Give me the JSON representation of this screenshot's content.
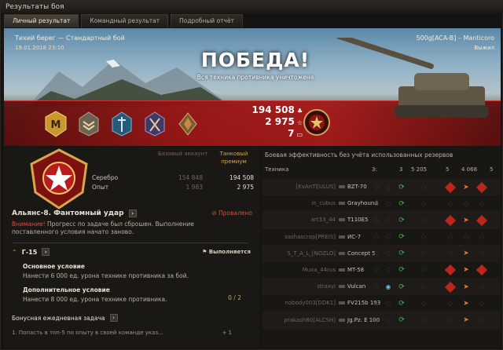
{
  "window": {
    "title": "Результаты боя"
  },
  "tabs": [
    {
      "label": "Личный результат",
      "active": true
    },
    {
      "label": "Командный результат",
      "active": false
    },
    {
      "label": "Подробный отчёт",
      "active": false
    }
  ],
  "hero": {
    "map_mode": "Тихий берег — Стандартный бой",
    "datetime": "19.01.2018 23:10",
    "player": "500g[ACA-B] – Manticoro",
    "vehicle_status": "Выжил",
    "result": "ПОБЕДА!",
    "result_sub": "Вся техника противника уничтожена",
    "credits_total": "194 508",
    "xp_total": "2 975",
    "free_xp_total": "7",
    "medals": [
      "mastery-badge-m",
      "sergeant-stripes-icon",
      "shield-medal-icon",
      "crossed-medal-icon",
      "diamond-medal-icon"
    ],
    "accent_red": "#a01818"
  },
  "earnings": {
    "base_label": "Базовый аккаунт",
    "premium_label": "Танковый премиум",
    "rows": [
      {
        "label": "Серебро",
        "base": "154 848",
        "premium": "194 508"
      },
      {
        "label": "Опыт",
        "base": "1 983",
        "premium": "2 975"
      }
    ]
  },
  "task": {
    "title": "Альянс-8. Фантомный удар",
    "status": "Провалено",
    "warning_word": "Внимание!",
    "warning_text": " Прогресс по задаче был сброшен. Выполнение поставленного условия начато заново.",
    "tank": "Г-15",
    "tank_status": "Выполняется",
    "main_cond_title": "Основное условие",
    "main_cond_text": "Нанести 6 000 ед. урона технике противника за бой.",
    "extra_cond_title": "Дополнительное условие",
    "extra_cond_text": "Нанести 8 000 ед. урона технике противника.",
    "extra_progress": "0 / 2",
    "daily_title": "Бонусная ежедневная задача",
    "daily_item": "1. Попасть в топ-5 по опыту в своей команде указ...",
    "daily_reward": "+ 1"
  },
  "efficiency": {
    "title": "Боевая эффективность без учёта использованных резервов",
    "col_tech": "Техника",
    "col_values": [
      "3:",
      "3",
      "5 205",
      "5",
      "4 068",
      "5"
    ],
    "rows": [
      {
        "player": "[KvAnTl[ULUS]",
        "tank": "BZT-70",
        "icons": [
          "dim",
          "dim",
          "green",
          "dim",
          "red",
          "orange",
          "red"
        ]
      },
      {
        "player": "in_cubus",
        "tank": "Grayhound",
        "icons": [
          "dim",
          "dim",
          "green",
          "dim",
          "dim",
          "dim",
          "dim"
        ]
      },
      {
        "player": "art33_44",
        "tank": "T110E5",
        "icons": [
          "dim",
          "dim",
          "green",
          "dim",
          "red",
          "orange",
          "red"
        ]
      },
      {
        "player": "sashascrap[PREIS]",
        "tank": "ИС-7",
        "icons": [
          "dim",
          "dim",
          "green",
          "dim",
          "dim",
          "dim",
          "dim"
        ]
      },
      {
        "player": "S_T_A_L_[NOZLO]",
        "tank": "Concept 5",
        "icons": [
          "dim",
          "dim",
          "green",
          "dim",
          "dim",
          "orange",
          "dim"
        ]
      },
      {
        "player": "Muxa_44rus",
        "tank": "MT-58",
        "icons": [
          "dim",
          "dim",
          "green",
          "dim",
          "red",
          "orange",
          "red"
        ]
      },
      {
        "player": "straxyi",
        "tank": "Vulcan",
        "icons": [
          "dim",
          "blue",
          "green",
          "dim",
          "red",
          "orange",
          "dim"
        ]
      },
      {
        "player": "nobody003[DDK1]",
        "tank": "FV215b 183",
        "icons": [
          "dim",
          "dim",
          "green",
          "dim",
          "dim",
          "orange",
          "dim"
        ]
      },
      {
        "player": "prakash80[ALCSH]",
        "tank": "Jg.Pz. E 100",
        "icons": [
          "dim",
          "dim",
          "green",
          "dim",
          "dim",
          "orange",
          "dim"
        ]
      }
    ]
  }
}
